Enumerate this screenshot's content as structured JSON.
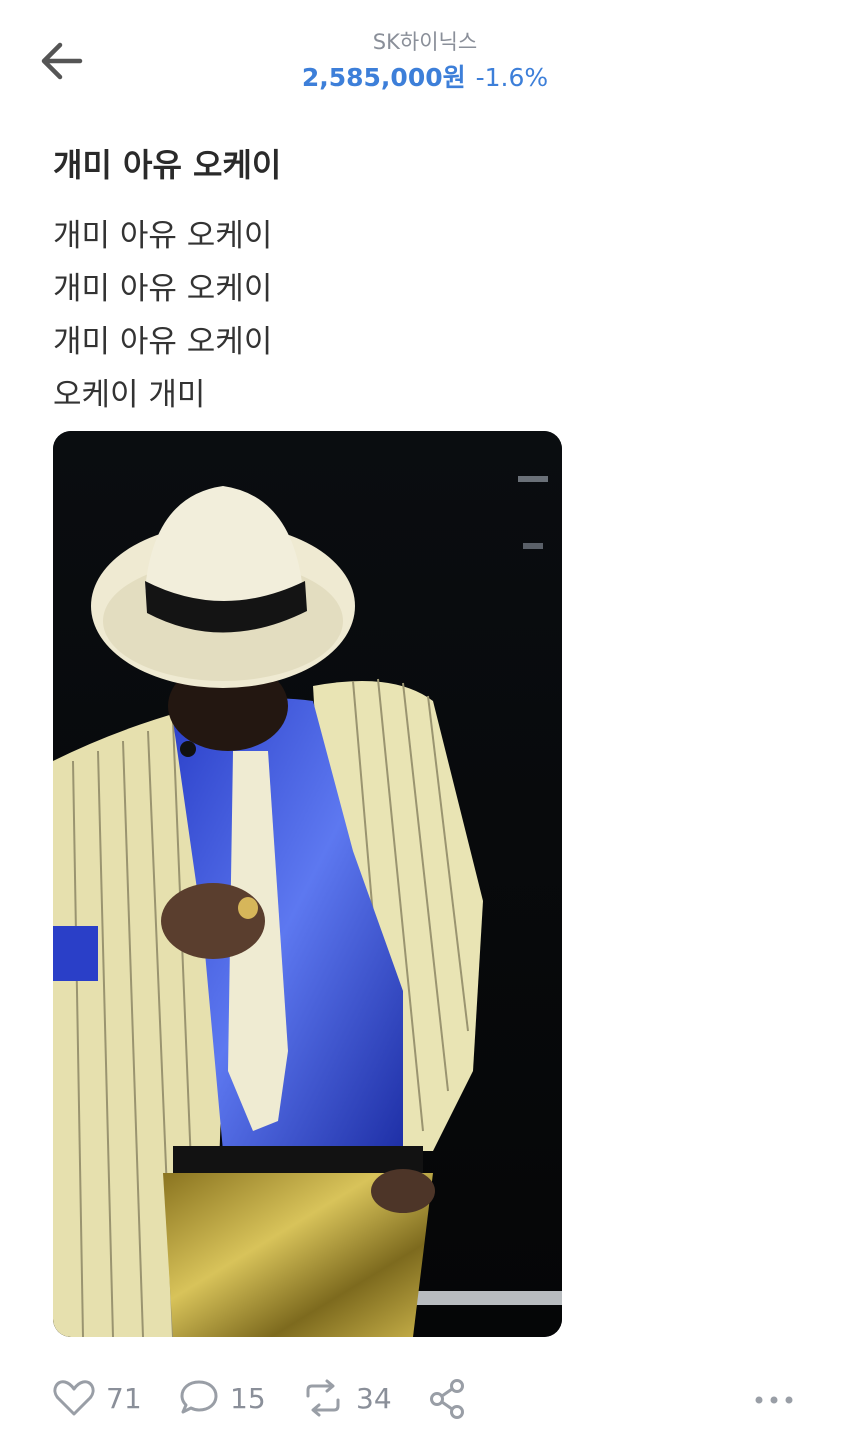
{
  "header": {
    "stock_name": "SK하이닉스",
    "price": "2,585,000원",
    "change": "-1.6%",
    "accent_color": "#3d7fd9"
  },
  "post": {
    "title": "개미 아유 오케이",
    "lines": [
      "개미 아유 오케이",
      "개미 아유 오케이",
      "개미 아유 오케이",
      "오케이 개미"
    ]
  },
  "actions": {
    "likes": "71",
    "comments": "15",
    "shares": "34"
  },
  "icons": [
    "back-arrow-icon",
    "heart-icon",
    "comment-icon",
    "repost-icon",
    "share-icon",
    "more-icon"
  ]
}
